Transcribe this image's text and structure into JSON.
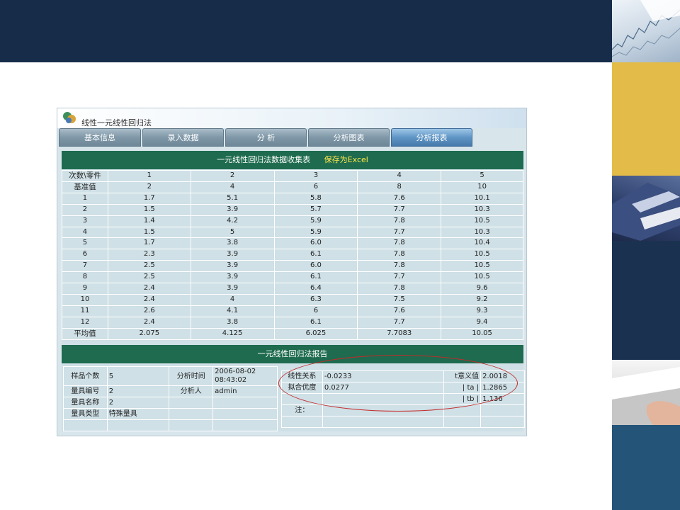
{
  "window": {
    "title": "线性一元线性回归法"
  },
  "tabs": [
    {
      "label": "基本信息"
    },
    {
      "label": "录入数据"
    },
    {
      "label": "分  析"
    },
    {
      "label": "分析图表"
    },
    {
      "label": "分析报表"
    }
  ],
  "active_tab": "分析报表",
  "collection_table": {
    "title": "一元线性回归法数据收集表",
    "save_link": "保存为Excel",
    "corner_label": "次数\\零件",
    "columns": [
      "1",
      "2",
      "3",
      "4",
      "5"
    ],
    "baseline_label": "基准值",
    "baseline": [
      "2",
      "4",
      "6",
      "8",
      "10"
    ],
    "rows": [
      {
        "n": "1",
        "values": [
          "1.7",
          "5.1",
          "5.8",
          "7.6",
          "10.1"
        ]
      },
      {
        "n": "2",
        "values": [
          "1.5",
          "3.9",
          "5.7",
          "7.7",
          "10.3"
        ]
      },
      {
        "n": "3",
        "values": [
          "1.4",
          "4.2",
          "5.9",
          "7.8",
          "10.5"
        ]
      },
      {
        "n": "4",
        "values": [
          "1.5",
          "5",
          "5.9",
          "7.7",
          "10.3"
        ]
      },
      {
        "n": "5",
        "values": [
          "1.7",
          "3.8",
          "6.0",
          "7.8",
          "10.4"
        ]
      },
      {
        "n": "6",
        "values": [
          "2.3",
          "3.9",
          "6.1",
          "7.8",
          "10.5"
        ]
      },
      {
        "n": "7",
        "values": [
          "2.5",
          "3.9",
          "6.0",
          "7.8",
          "10.5"
        ]
      },
      {
        "n": "8",
        "values": [
          "2.5",
          "3.9",
          "6.1",
          "7.7",
          "10.5"
        ]
      },
      {
        "n": "9",
        "values": [
          "2.4",
          "3.9",
          "6.4",
          "7.8",
          "9.6"
        ]
      },
      {
        "n": "10",
        "values": [
          "2.4",
          "4",
          "6.3",
          "7.5",
          "9.2"
        ]
      },
      {
        "n": "11",
        "values": [
          "2.6",
          "4.1",
          "6",
          "7.6",
          "9.3"
        ]
      },
      {
        "n": "12",
        "values": [
          "2.4",
          "3.8",
          "6.1",
          "7.7",
          "9.4"
        ]
      }
    ],
    "average_label": "平均值",
    "averages": [
      "2.075",
      "4.125",
      "6.025",
      "7.7083",
      "10.05"
    ]
  },
  "report": {
    "title": "一元线性回归法报告",
    "sample_count_label": "样品个数",
    "sample_count": "5",
    "analysis_time_label": "分析时间",
    "analysis_date": "2006-08-02",
    "analysis_clock": "08:43:02",
    "gauge_no_label": "量具编号",
    "gauge_no": "2",
    "analyst_label": "分析人",
    "analyst": "admin",
    "gauge_name_label": "量具名称",
    "gauge_name": "2",
    "gauge_type_label": "量具类型",
    "gauge_type": "特殊量具",
    "linearity_label": "线性关系",
    "linearity": "-0.0233",
    "t_label": "t意义值",
    "t_value": "2.0018",
    "fit_label": "拟合优度",
    "fit": "0.0277",
    "ta_label": "| ta |",
    "ta_value": "1.2865",
    "tb_label": "| tb |",
    "tb_value": "1.136",
    "note_label": "注："
  },
  "colors": {
    "header_green": "#1e6b4f",
    "save_link_yellow": "#ffe84a",
    "highlight_ellipse": "#c32a2a",
    "band_navy": "#162c49",
    "accent_gold": "#e3bb49"
  }
}
